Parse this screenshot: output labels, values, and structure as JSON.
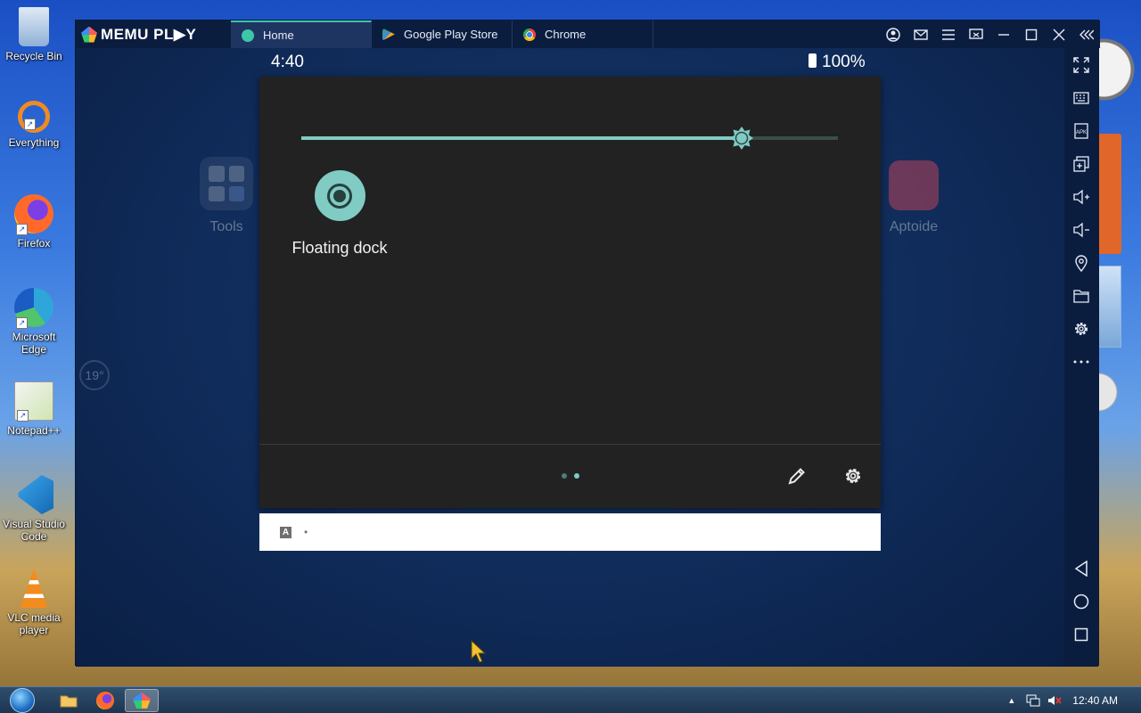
{
  "desktop": {
    "icons": [
      {
        "label": "Recycle Bin",
        "icon": "recycle-bin-icon",
        "color": "#9fc3e8"
      },
      {
        "label": "Everything",
        "icon": "everything-search-icon",
        "color": "#f08a24"
      },
      {
        "label": "Firefox",
        "icon": "firefox-icon",
        "color": "#ff6a2b"
      },
      {
        "label": "Microsoft Edge",
        "icon": "edge-icon",
        "color": "#2fa6d9"
      },
      {
        "label": "Notepad++",
        "icon": "notepad-plus-plus-icon",
        "color": "#8cc152"
      },
      {
        "label": "Visual Studio Code",
        "icon": "vscode-icon",
        "color": "#1f8ad2"
      },
      {
        "label": "VLC media player",
        "icon": "vlc-icon",
        "color": "#f28c1e"
      }
    ]
  },
  "emulator": {
    "logo_text": "MEMU PL▶Y",
    "tabs": [
      {
        "label": "Home",
        "icon": "home-tab-icon",
        "color": "#3ec6a8",
        "active": true
      },
      {
        "label": "Google Play Store",
        "icon": "play-store-icon",
        "color": "#34a853",
        "active": false
      },
      {
        "label": "Chrome",
        "icon": "chrome-icon",
        "color": "#fbbc05",
        "active": false
      }
    ],
    "window_controls": [
      "account-icon",
      "mail-icon",
      "menu-icon",
      "screen-cast-icon",
      "minimize-icon",
      "maximize-icon",
      "close-icon",
      "collapse-sidebar-icon"
    ]
  },
  "android": {
    "status": {
      "time": "4:40",
      "battery": "100%"
    },
    "home_apps": [
      {
        "label": "Tools",
        "icon": "tools-folder-icon"
      },
      {
        "label": "Aptoide",
        "icon": "aptoide-icon"
      }
    ],
    "weather_badge": "19°",
    "quick_settings": {
      "brightness_level": 0.82,
      "tile": {
        "label": "Floating dock",
        "icon": "floating-dock-icon"
      },
      "page_count": 2,
      "active_page": 2
    },
    "notification": {
      "icon_letter": "A",
      "bullet": "•"
    }
  },
  "toolbar_buttons": [
    "fullscreen-icon",
    "keyboard-icon",
    "apk-icon",
    "multi-instance-icon",
    "volume-up-icon",
    "volume-down-icon",
    "location-icon",
    "folder-icon",
    "settings-icon",
    "more-icon",
    "back-icon",
    "home-icon",
    "recents-icon"
  ],
  "taskbar": {
    "apps": [
      {
        "icon": "file-explorer-icon",
        "active": false
      },
      {
        "icon": "firefox-icon",
        "active": false
      },
      {
        "icon": "memu-icon",
        "active": true
      }
    ],
    "clock": "12:40 AM"
  },
  "colors": {
    "accent": "#80cbc4",
    "panel_bg": "#222222",
    "window_bg": "#0b1d3f"
  }
}
